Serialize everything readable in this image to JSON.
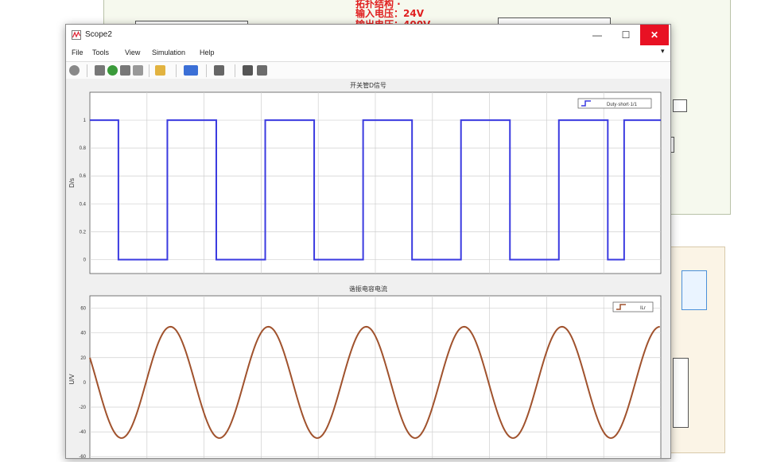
{
  "background": {
    "note_line1": "输入电压：24V",
    "note_line2": "输出电压：400V"
  },
  "window": {
    "title": "Scope2",
    "controls": {
      "minimize": "—",
      "maximize": "☐",
      "close": "✕"
    }
  },
  "menu": [
    "File",
    "Tools",
    "View",
    "Simulation",
    "Help"
  ],
  "toolbar_icons": [
    "settings-icon",
    "step-back-icon",
    "run-icon",
    "step-forward-icon",
    "stop-icon",
    "highlight-icon",
    "zoom-icon",
    "fit-icon",
    "cursor-icon",
    "edit-icon"
  ],
  "plots": [
    {
      "title": "开关管D信号",
      "ylabel": "D/s",
      "legend": "Duty·short·1/1",
      "yticks": [
        "1",
        "0.8",
        "0.6",
        "0.4",
        "0.2",
        "0"
      ],
      "color": "#3a3ae0"
    },
    {
      "title": "谐振电容电流",
      "ylabel": "U/V",
      "legend": "ILr",
      "yticks": [
        "60",
        "40",
        "20",
        "0",
        "-20",
        "-40",
        "-60"
      ],
      "color": "#a0522d"
    }
  ],
  "chart_data": [
    {
      "type": "line",
      "title": "开关管D信号",
      "ylabel": "D/s",
      "ylim": [
        -0.1,
        1.2
      ],
      "grid": true,
      "legend_position": "top-right",
      "series": [
        {
          "name": "Duty·short·1/1",
          "color": "#3a3ae0",
          "x": [
            0,
            1.4,
            1.4,
            3.8,
            3.8,
            6.2,
            6.2,
            8.6,
            8.6,
            11.0,
            11.0,
            13.4,
            13.4,
            15.8,
            15.8,
            18.2,
            18.2,
            20.6,
            20.6,
            23.0,
            23.0,
            25.4,
            25.4,
            26.2,
            26.2,
            28.0
          ],
          "y": [
            1,
            1,
            0,
            0,
            1,
            1,
            0,
            0,
            1,
            1,
            0,
            0,
            1,
            1,
            0,
            0,
            1,
            1,
            0,
            0,
            1,
            1,
            0,
            0,
            1,
            1
          ]
        }
      ]
    },
    {
      "type": "line",
      "title": "谐振电容电流",
      "ylabel": "U/V",
      "ylim": [
        -65,
        70
      ],
      "grid": true,
      "legend_position": "top-right",
      "series": [
        {
          "name": "ILr",
          "color": "#a0522d",
          "amplitude": 45,
          "period": 4.8,
          "phase_offset_x": 0.0,
          "initial_value": 20
        }
      ]
    }
  ]
}
